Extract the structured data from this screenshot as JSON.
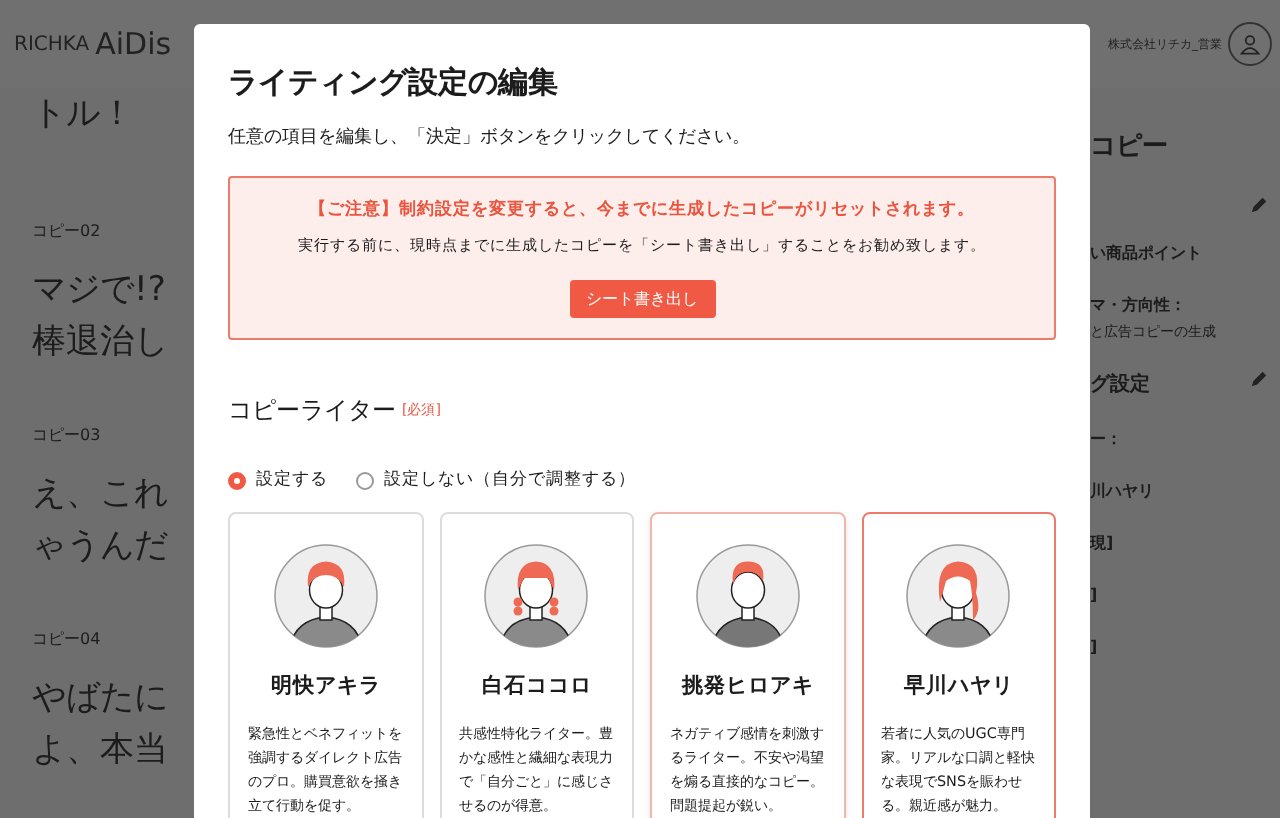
{
  "header": {
    "logo_brand": "RICHKA",
    "logo_product": "AiDis",
    "user": "株式会社リチカ_営業"
  },
  "copies": [
    {
      "lines": [
        "トル！"
      ]
    },
    {
      "label": "コピー02",
      "lines": [
        "マジで!?",
        "棒退治し"
      ]
    },
    {
      "label": "コピー03",
      "lines": [
        "え、これ",
        "ゃうんだ"
      ]
    },
    {
      "label": "コピー04",
      "lines": [
        "やばたに",
        "よ、本当"
      ]
    }
  ],
  "side": [
    {
      "kind": "heading",
      "text": "コピー"
    },
    {
      "kind": "edit"
    },
    {
      "kind": "bold",
      "text": "い商品ポイント"
    },
    {
      "kind": "bold",
      "text": "マ・方向性："
    },
    {
      "kind": "small",
      "text": "と広告コピーの生成"
    },
    {
      "kind": "heading2",
      "text": "グ設定"
    },
    {
      "kind": "bold",
      "text": "ー："
    },
    {
      "kind": "bold",
      "text": "川ハヤリ"
    },
    {
      "kind": "bold",
      "text": "現]"
    },
    {
      "kind": "bold",
      "text": "]"
    },
    {
      "kind": "bold",
      "text": "]"
    }
  ],
  "dialog": {
    "title": "ライティング設定の編集",
    "subtitle": "任意の項目を編集し、「決定」ボタンをクリックしてください。",
    "notice": {
      "warning": "【ご注意】制約設定を変更すると、今までに生成したコピーがリセットされます。",
      "advice": "実行する前に、現時点までに生成したコピーを「シート書き出し」することをお勧め致します。",
      "button": "シート書き出し"
    },
    "section": {
      "label": "コピーライター",
      "required": "[必須]"
    },
    "options": [
      {
        "label": "設定する",
        "selected": true
      },
      {
        "label": "設定しない（自分で調整する）",
        "selected": false
      }
    ],
    "writers": [
      {
        "name": "明快アキラ",
        "description": "緊急性とベネフィットを強調するダイレクト広告のプロ。購買意欲を掻き立て行動を促す。",
        "kind": "short",
        "selected": false,
        "hovered": false
      },
      {
        "name": "白石ココロ",
        "description": "共感性特化ライター。豊かな感性と繊細な表現力で「自分ごと」に感じさせるのが得意。",
        "kind": "braids",
        "selected": false,
        "hovered": false
      },
      {
        "name": "挑発ヒロアキ",
        "description": "ネガティブ感情を刺激するライター。不安や渇望を煽る直接的なコピー。問題提起が鋭い。",
        "kind": "suit",
        "selected": false,
        "hovered": true
      },
      {
        "name": "早川ハヤリ",
        "description": "若者に人気のUGC専門家。リアルな口調と軽快な表現でSNSを賑わせる。親近感が魅力。",
        "kind": "long",
        "selected": true,
        "hovered": false
      }
    ]
  }
}
